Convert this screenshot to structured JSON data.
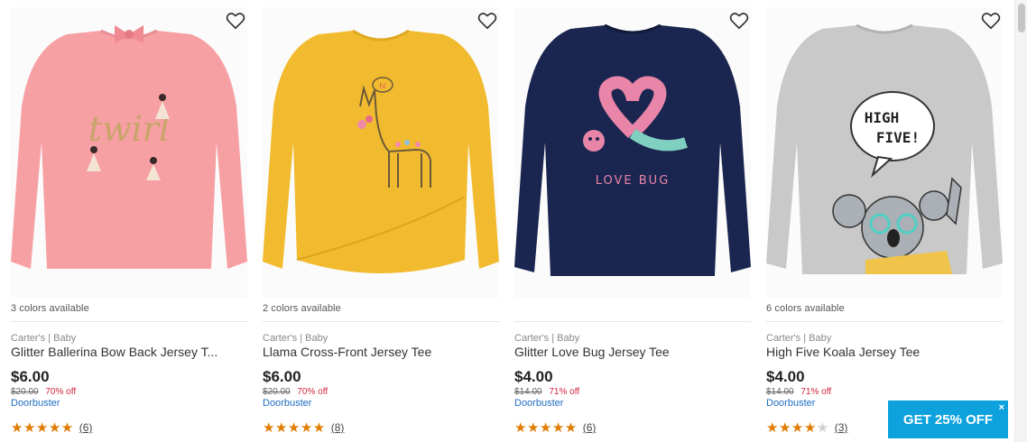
{
  "products": [
    {
      "colors_text": "3 colors available",
      "brand": "Carter's | Baby",
      "title": "Glitter Ballerina Bow Back Jersey T...",
      "price": "$6.00",
      "original_price": "$20.00",
      "discount": "70% off",
      "badge": "Doorbuster",
      "rating": 5,
      "review_count": "(6)",
      "shirt_color": "#f7a0a4",
      "graphic_text": "twirl"
    },
    {
      "colors_text": "2 colors available",
      "brand": "Carter's | Baby",
      "title": "Llama Cross-Front Jersey Tee",
      "price": "$6.00",
      "original_price": "$20.00",
      "discount": "70% off",
      "badge": "Doorbuster",
      "rating": 5,
      "review_count": "(8)",
      "shirt_color": "#f2bb2f",
      "graphic_text": "hi"
    },
    {
      "colors_text": "",
      "brand": "Carter's | Baby",
      "title": "Glitter Love Bug Jersey Tee",
      "price": "$4.00",
      "original_price": "$14.00",
      "discount": "71% off",
      "badge": "Doorbuster",
      "rating": 5,
      "review_count": "(6)",
      "shirt_color": "#1b2650",
      "graphic_text": "LOVE BUG"
    },
    {
      "colors_text": "6 colors available",
      "brand": "Carter's | Baby",
      "title": "High Five Koala Jersey Tee",
      "price": "$4.00",
      "original_price": "$14.00",
      "discount": "71% off",
      "badge": "Doorbuster",
      "rating": 4.5,
      "review_count": "(3)",
      "shirt_color": "#c9c9c9",
      "graphic_text": "HIGH FIVE!"
    }
  ],
  "promo": {
    "label": "GET 25% OFF",
    "close": "×",
    "color": "#0da2dd"
  },
  "icons": {
    "favorite": "heart-outline-icon",
    "star": "star-icon"
  }
}
